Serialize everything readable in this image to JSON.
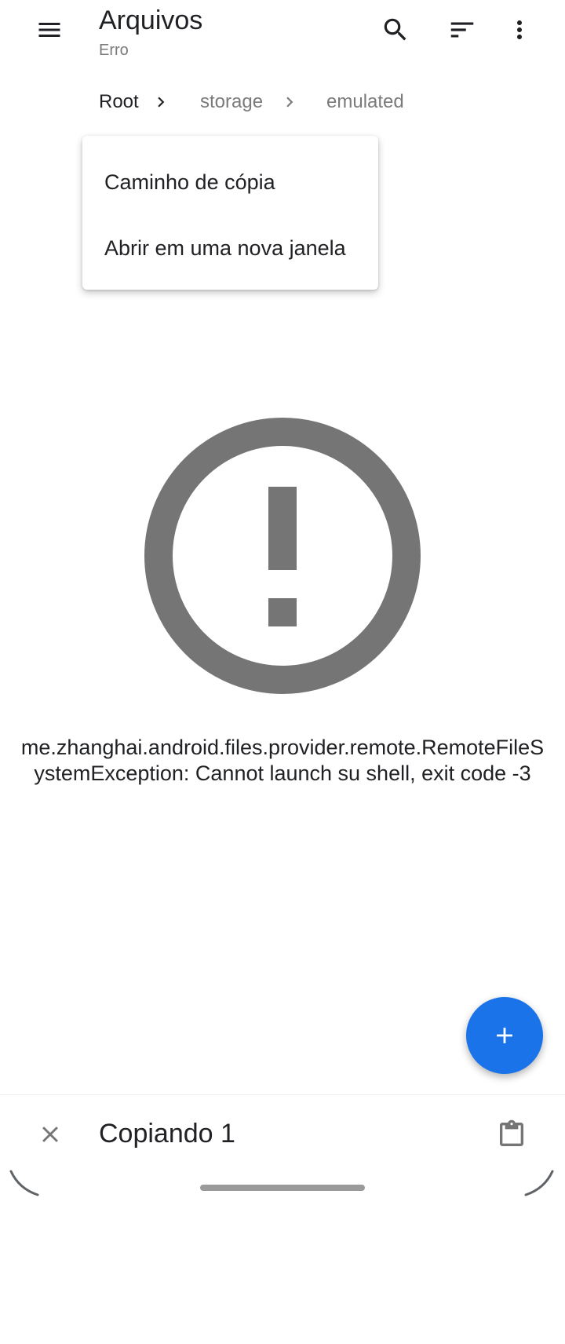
{
  "appbar": {
    "title": "Arquivos",
    "subtitle": "Erro",
    "icons": [
      "menu-icon",
      "search-icon",
      "sort-icon",
      "more-vert-icon"
    ]
  },
  "breadcrumb": {
    "items": [
      "Root",
      "storage",
      "emulated"
    ]
  },
  "popup_menu": {
    "items": [
      "Caminho de cópia",
      "Abrir em uma nova janela"
    ]
  },
  "error": {
    "icon": "error-outline-icon",
    "message": "me.zhanghai.android.files.provider.remote.RemoteFileSystemException: Cannot launch su shell, exit code -3"
  },
  "fab": {
    "icon": "add-icon"
  },
  "bottom_bar": {
    "title": "Copiando 1",
    "icons": [
      "close-icon",
      "clipboard-icon"
    ]
  },
  "colors": {
    "accent": "#1a73e8",
    "icon_gray": "#757575",
    "text_primary": "#202124",
    "text_secondary": "#7a7a7a"
  }
}
